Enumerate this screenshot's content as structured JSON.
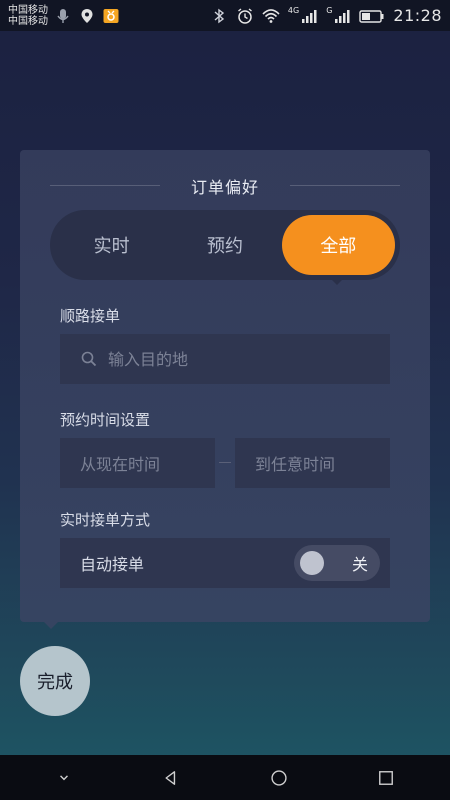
{
  "status_bar": {
    "carrier_1": "中国移动",
    "carrier_2": "中国移动",
    "network_label_1": "4G",
    "network_label_2": "G",
    "time": "21:28"
  },
  "card": {
    "title": "订单偏好",
    "segments": [
      {
        "label": "实时",
        "active": false
      },
      {
        "label": "预约",
        "active": false
      },
      {
        "label": "全部",
        "active": true
      }
    ],
    "route_section_label": "顺路接单",
    "destination_placeholder": "输入目的地",
    "booking_time_label": "预约时间设置",
    "time_from_placeholder": "从现在时间",
    "time_to_placeholder": "到任意时间",
    "realtime_method_label": "实时接单方式",
    "auto_accept_label": "自动接单",
    "toggle_state_text": "关"
  },
  "done_button": {
    "label": "完成"
  },
  "colors": {
    "accent": "#f5901e",
    "card_bg": "#353d5c",
    "field_bg": "#2f3650",
    "done_bg": "#b5c5cc"
  }
}
